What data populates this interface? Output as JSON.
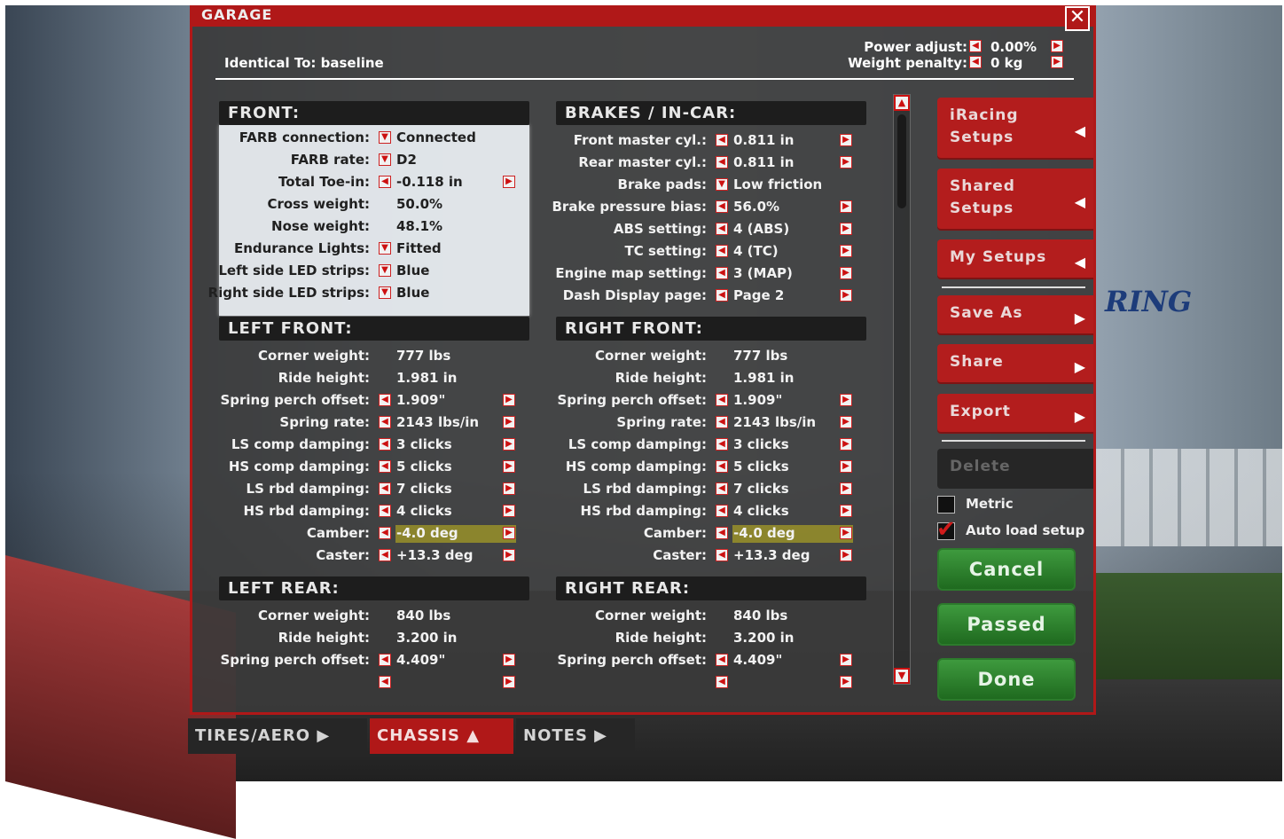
{
  "window": {
    "title": "GARAGE",
    "close_glyph": "✕",
    "identical_to": "Identical To: baseline",
    "power_adjust_label": "Power adjust:",
    "power_adjust_value": "0.00%",
    "weight_penalty_label": "Weight penalty:",
    "weight_penalty_value": "0 kg"
  },
  "arrows": {
    "left": "◀",
    "right": "▶",
    "down": "▼",
    "up": "▲"
  },
  "front": {
    "title": "FRONT:",
    "rows": [
      {
        "label": "FARB connection:",
        "value": "Connected"
      },
      {
        "label": "FARB rate:",
        "value": "D2"
      },
      {
        "label": "Total Toe-in:",
        "value": "-0.118 in"
      },
      {
        "label": "Cross weight:",
        "value": "50.0%"
      },
      {
        "label": "Nose weight:",
        "value": "48.1%"
      },
      {
        "label": "Endurance Lights:",
        "value": "Fitted"
      },
      {
        "label": "Left side LED strips:",
        "value": "Blue"
      },
      {
        "label": "Right side LED strips:",
        "value": "Blue"
      }
    ]
  },
  "brakes": {
    "title": "BRAKES / IN-CAR:",
    "rows": [
      {
        "label": "Front master cyl.:",
        "value": "0.811 in"
      },
      {
        "label": "Rear master cyl.:",
        "value": "0.811 in"
      },
      {
        "label": "Brake pads:",
        "value": "Low friction"
      },
      {
        "label": "Brake pressure bias:",
        "value": "56.0%"
      },
      {
        "label": "ABS setting:",
        "value": "4 (ABS)"
      },
      {
        "label": "TC setting:",
        "value": "4 (TC)"
      },
      {
        "label": "Engine map setting:",
        "value": "3 (MAP)"
      },
      {
        "label": "Dash Display page:",
        "value": "Page 2"
      }
    ]
  },
  "left_front": {
    "title": "LEFT FRONT:",
    "rows": [
      {
        "label": "Corner weight:",
        "value": "777 lbs"
      },
      {
        "label": "Ride height:",
        "value": "1.981 in"
      },
      {
        "label": "Spring perch offset:",
        "value": "1.909\""
      },
      {
        "label": "Spring rate:",
        "value": "2143 lbs/in"
      },
      {
        "label": "LS comp damping:",
        "value": "3 clicks"
      },
      {
        "label": "HS comp damping:",
        "value": "5 clicks"
      },
      {
        "label": "LS rbd damping:",
        "value": "7 clicks"
      },
      {
        "label": "HS rbd damping:",
        "value": "4 clicks"
      },
      {
        "label": "Camber:",
        "value": "-4.0 deg"
      },
      {
        "label": "Caster:",
        "value": "+13.3 deg"
      }
    ]
  },
  "right_front": {
    "title": "RIGHT FRONT:",
    "rows": [
      {
        "label": "Corner weight:",
        "value": "777 lbs"
      },
      {
        "label": "Ride height:",
        "value": "1.981 in"
      },
      {
        "label": "Spring perch offset:",
        "value": "1.909\""
      },
      {
        "label": "Spring rate:",
        "value": "2143 lbs/in"
      },
      {
        "label": "LS comp damping:",
        "value": "3 clicks"
      },
      {
        "label": "HS comp damping:",
        "value": "5 clicks"
      },
      {
        "label": "LS rbd damping:",
        "value": "7 clicks"
      },
      {
        "label": "HS rbd damping:",
        "value": "4 clicks"
      },
      {
        "label": "Camber:",
        "value": "-4.0 deg"
      },
      {
        "label": "Caster:",
        "value": "+13.3 deg"
      }
    ]
  },
  "left_rear": {
    "title": "LEFT REAR:",
    "rows": [
      {
        "label": "Corner weight:",
        "value": "840 lbs"
      },
      {
        "label": "Ride height:",
        "value": "3.200 in"
      },
      {
        "label": "Spring perch offset:",
        "value": "4.409\""
      }
    ]
  },
  "right_rear": {
    "title": "RIGHT REAR:",
    "rows": [
      {
        "label": "Corner weight:",
        "value": "840 lbs"
      },
      {
        "label": "Ride height:",
        "value": "3.200 in"
      },
      {
        "label": "Spring perch offset:",
        "value": "4.409\""
      }
    ]
  },
  "sidebar": {
    "iracing_setups": "iRacing Setups",
    "shared_setups": "Shared Setups",
    "my_setups": "My Setups",
    "save_as": "Save As",
    "share": "Share",
    "export": "Export",
    "delete": "Delete",
    "metric": "Metric",
    "auto_load_setup": "Auto load setup",
    "cancel": "Cancel",
    "passed": "Passed",
    "done": "Done"
  },
  "tabs": {
    "tires_aero": "TIRES/AERO ▶",
    "chassis": "CHASSIS ▲",
    "notes": "NOTES ▶"
  },
  "background": {
    "track_sign": "RING"
  },
  "colors": {
    "accent_red": "#b01818",
    "panel_gray": "#3a3a3a",
    "highlight_yellow": "#c9bb1c",
    "action_green": "#2e8a2e"
  }
}
